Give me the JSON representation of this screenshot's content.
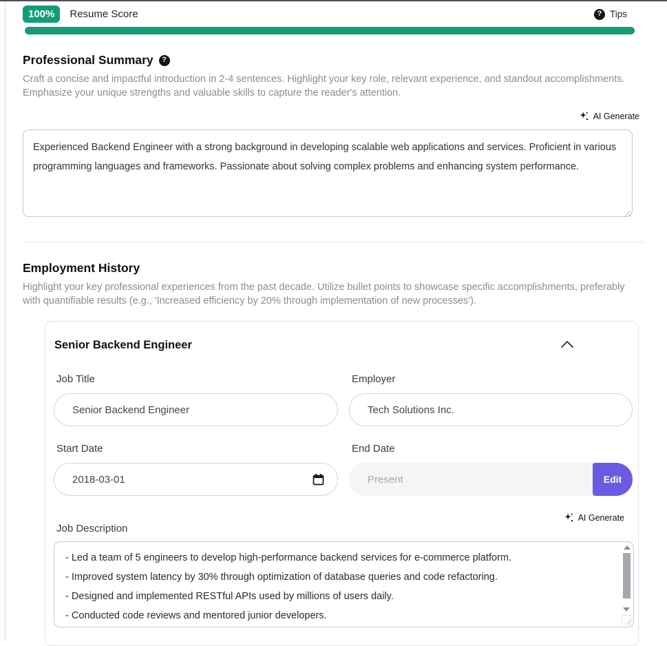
{
  "topbar": {
    "score": "100%",
    "title": "Resume Score",
    "tips": "Tips",
    "progress_percent": 100
  },
  "colors": {
    "green": "#129c78",
    "purple": "#6a5be2"
  },
  "summary": {
    "heading": "Professional Summary",
    "description": "Craft a concise and impactful introduction in 2-4 sentences. Highlight your key role, relevant experience, and standout accomplishments. Emphasize your unique strengths and valuable skills to capture the reader's attention.",
    "ai_generate": "AI Generate",
    "value": "Experienced Backend Engineer with a strong background in developing scalable web applications and services. Proficient in various programming languages and frameworks. Passionate about solving complex problems and enhancing system performance."
  },
  "employment": {
    "heading": "Employment History",
    "description": "Highlight your key professional experiences from the past decade. Utilize bullet points to showcase specific accomplishments, preferably with quantifiable results (e.g., 'Increased efficiency by 20% through implementation of new processes').",
    "card": {
      "title": "Senior Backend Engineer",
      "fields": {
        "job_title": {
          "label": "Job Title",
          "value": "Senior Backend Engineer"
        },
        "employer": {
          "label": "Employer",
          "value": "Tech Solutions Inc."
        },
        "start_date": {
          "label": "Start Date",
          "value": "2018-03-01"
        },
        "end_date": {
          "label": "End Date",
          "placeholder": "Present",
          "edit_button": "Edit"
        }
      },
      "job_description": {
        "label": "Job Description",
        "ai_generate": "AI Generate",
        "value": "- Led a team of 5 engineers to develop high-performance backend services for e-commerce platform.\n- Improved system latency by 30% through optimization of database queries and code refactoring.\n- Designed and implemented RESTful APIs used by millions of users daily.\n- Conducted code reviews and mentored junior developers."
      }
    }
  }
}
